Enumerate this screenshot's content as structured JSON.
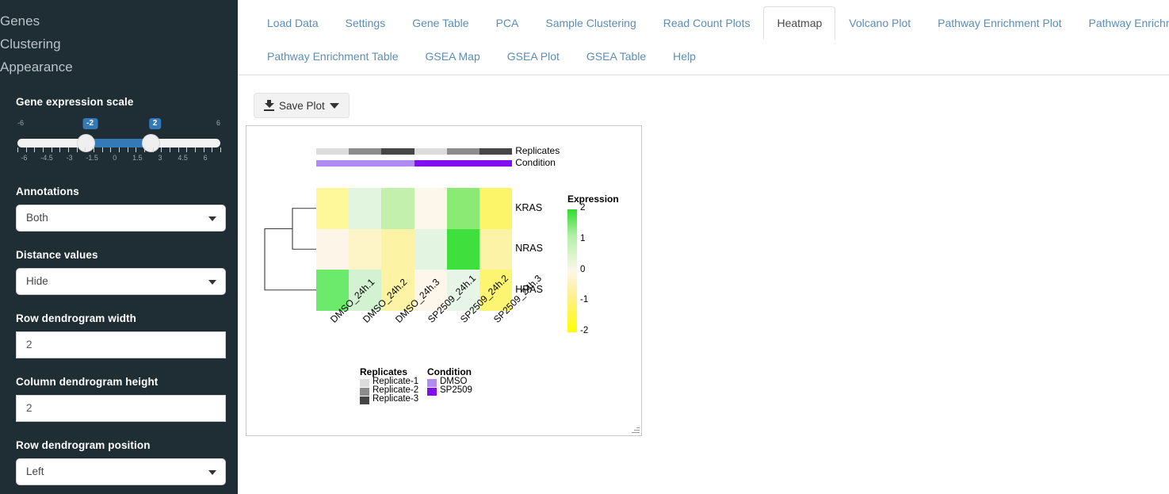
{
  "sidebar": {
    "nav": [
      {
        "label": "Genes"
      },
      {
        "label": "Clustering"
      },
      {
        "label": "Appearance"
      }
    ],
    "gene_expression_scale": {
      "label": "Gene expression scale",
      "min_end_label": "-6",
      "max_end_label": "6",
      "low_value": "-2",
      "high_value": "2",
      "tick_labels": [
        "-6",
        "-4.5",
        "-3",
        "-1.5",
        "0",
        "1.5",
        "3",
        "4.5",
        "6"
      ],
      "accent_color": "#337ab7"
    },
    "annotations": {
      "label": "Annotations",
      "value": "Both"
    },
    "distance_values": {
      "label": "Distance values",
      "value": "Hide"
    },
    "row_dendrogram_width": {
      "label": "Row dendrogram width",
      "value": "2"
    },
    "column_dendrogram_height": {
      "label": "Column dendrogram height",
      "value": "2"
    },
    "row_dendrogram_position": {
      "label": "Row dendrogram position",
      "value": "Left"
    }
  },
  "tabs": {
    "row1": [
      {
        "label": "Load Data",
        "active": false
      },
      {
        "label": "Settings",
        "active": false
      },
      {
        "label": "Gene Table",
        "active": false
      },
      {
        "label": "PCA",
        "active": false
      },
      {
        "label": "Sample Clustering",
        "active": false
      },
      {
        "label": "Read Count Plots",
        "active": false
      },
      {
        "label": "Heatmap",
        "active": true
      },
      {
        "label": "Volcano Plot",
        "active": false
      },
      {
        "label": "Pathway Enrichment Plot",
        "active": false
      },
      {
        "label": "Pathway Enrichment Map",
        "active": false
      }
    ],
    "row2": [
      {
        "label": "Pathway Enrichment Table",
        "active": false
      },
      {
        "label": "GSEA Map",
        "active": false
      },
      {
        "label": "GSEA Plot",
        "active": false
      },
      {
        "label": "GSEA Table",
        "active": false
      },
      {
        "label": "Help",
        "active": false
      }
    ]
  },
  "toolbar": {
    "save_plot_label": "Save Plot",
    "download_icon": "download-icon",
    "caret_icon": "caret-down-icon"
  },
  "chart_data": {
    "type": "heatmap",
    "title": "",
    "rows": [
      "KRAS",
      "NRAS",
      "HRAS"
    ],
    "columns": [
      "DMSO_24h.1",
      "DMSO_24h.2",
      "DMSO_24h.3",
      "SP2509_24h.1",
      "SP2509_24h.2",
      "SP2509_24h.3"
    ],
    "values": [
      [
        -1.45,
        0.45,
        1.05,
        0.05,
        1.75,
        -1.6
      ],
      [
        -0.15,
        -0.55,
        -1.05,
        0.35,
        2.0,
        -0.85
      ],
      [
        1.85,
        0.65,
        -1.0,
        0.05,
        0.35,
        -1.7
      ]
    ],
    "cell_colors": [
      [
        "#fff89a",
        "#e2f5df",
        "#c3f0ac",
        "#fdf6ea",
        "#8aea74",
        "#fdf569"
      ],
      [
        "#fdf6e8",
        "#fdf4c8",
        "#fdf3a5",
        "#e3f5e0",
        "#3ee03e",
        "#fdf3a7"
      ],
      [
        "#6cea6c",
        "#d2f2d2",
        "#fdf3a5",
        "#fdf6ea",
        "#e7f5e7",
        "#fdf472"
      ]
    ],
    "colorbar": {
      "title": "Expression",
      "ticks": [
        "2",
        "1",
        "0",
        "-1",
        "-2"
      ],
      "min": -2,
      "max": 2,
      "low_color": "#ffff00",
      "mid_color": "#fdf6ea",
      "high_color": "#2fdc2f"
    },
    "column_annotations": [
      {
        "name": "Replicates",
        "values": [
          "Replicate-1",
          "Replicate-2",
          "Replicate-3",
          "Replicate-1",
          "Replicate-2",
          "Replicate-3"
        ],
        "colors": [
          "#dcdcdc",
          "#8c8c8c",
          "#464646",
          "#dcdcdc",
          "#8c8c8c",
          "#464646"
        ]
      },
      {
        "name": "Condition",
        "values": [
          "DMSO",
          "DMSO",
          "DMSO",
          "SP2509",
          "SP2509",
          "SP2509"
        ],
        "colors": [
          "#b18cf0",
          "#b18cf0",
          "#b18cf0",
          "#7f0ff0",
          "#7f0ff0",
          "#7f0ff0"
        ]
      }
    ],
    "legends": [
      {
        "title": "Replicates",
        "items": [
          {
            "label": "Replicate-1",
            "color": "#dcdcdc"
          },
          {
            "label": "Replicate-2",
            "color": "#8c8c8c"
          },
          {
            "label": "Replicate-3",
            "color": "#464646"
          }
        ]
      },
      {
        "title": "Condition",
        "items": [
          {
            "label": "DMSO",
            "color": "#b18cf0"
          },
          {
            "label": "SP2509",
            "color": "#7f0ff0"
          }
        ]
      }
    ],
    "row_dendrogram": {
      "position": "left",
      "merges": "KRAS+NRAS then HRAS"
    }
  }
}
